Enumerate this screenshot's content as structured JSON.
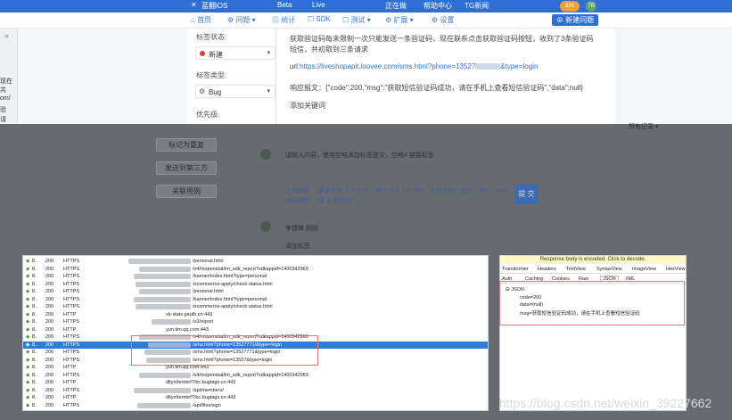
{
  "topbar": {
    "items": [
      "蓝翻iOS",
      "Beta",
      "Live",
      "正在做",
      "帮助中心",
      "TG新闻"
    ],
    "badge": "826",
    "avatar2": "TB"
  },
  "nav": {
    "home": "首页",
    "issues": "问题",
    "stats": "统计",
    "sdk": "SDK",
    "test": "测试",
    "ext": "扩展",
    "settings": "设置",
    "new_issue": "新建问题"
  },
  "sidepanel": {
    "status_label": "标签状态:",
    "status_value": "新建",
    "type_label": "标签类型:",
    "type_value": "Bug",
    "priority_label": "优先级:"
  },
  "content": {
    "line1": "获取验证码每未限制一次只能发送一条验证码，现在联系点击获取验证码按钮，收到了3条验证码",
    "line2": "短信，共初取到三条请求",
    "url_prefix": "url:",
    "url": "https://liveshopapit.loovee.com/sms.html?phone=13527",
    "url_suffix": "&type=login",
    "resp": "响应报文：{\"code\":200,\"msg\":\"获取短信验证码成功，请在手机上查看短信验证码\",\"data\":null}",
    "add_keyword": "添加关键词"
  },
  "overlay": {
    "btn1": "标记为重复",
    "btn2": "发送到第三方",
    "btn3": "关联用例",
    "sort": "所有记录",
    "comment_placeholder": "请输入内容，使用空格添加标签提交，空格# 链接标签",
    "upload": "上传附件 （最多上传 3 个文件，每个小于 100 MB，支持文档、图片、IPA、APK 和压缩包） 或 从剪贴板",
    "submit": "提 交",
    "user": "李建峰",
    "user_note": "刚刚",
    "add_label": "添加标签"
  },
  "fiddler": {
    "rows": [
      {
        "id": "8..",
        "code": "200",
        "proto": "HTTPS",
        "url": "/personal.html"
      },
      {
        "id": "8..",
        "code": "200",
        "proto": "HTTPS",
        "url": "/v4/mopenstat/im_sdk_report?sdkappid=1400342969"
      },
      {
        "id": "8..",
        "code": "200",
        "proto": "HTTPS",
        "url": "/banner/index.html?type=personal"
      },
      {
        "id": "8..",
        "code": "200",
        "proto": "HTTPS",
        "url": "/ecommerce-apply/check-status.html"
      },
      {
        "id": "8..",
        "code": "200",
        "proto": "HTTPS",
        "url": "/personal.html"
      },
      {
        "id": "8..",
        "code": "200",
        "proto": "HTTPS",
        "url": "/banner/index.html?type=personal"
      },
      {
        "id": "8..",
        "code": "200",
        "proto": "HTTPS",
        "url": "/ecommerce-apply/check-status.html"
      },
      {
        "id": "8..",
        "code": "200",
        "proto": "HTTP",
        "url": "xk-stats.gauth.cn:443"
      },
      {
        "id": "8..",
        "code": "200",
        "proto": "HTTPS",
        "url": "/v3/report"
      },
      {
        "id": "8..",
        "code": "200",
        "proto": "HTTP",
        "url": "yun.tim.qq.com:443"
      },
      {
        "id": "8..",
        "code": "200",
        "proto": "HTTPS",
        "url": "/v4/mopenstat/im_sdk_report?sdkappid=1400342969"
      },
      {
        "id": "8..",
        "code": "200",
        "proto": "HTTPS",
        "url": "/sms.html?phone=13527771/&type=login"
      },
      {
        "id": "8..",
        "code": "200",
        "proto": "HTTPS",
        "url": "/sms.html?phone=13527771&type=login"
      },
      {
        "id": "8..",
        "code": "200",
        "proto": "HTTPS",
        "url": "/sms.html?phone=13527&type=login"
      },
      {
        "id": "8..",
        "code": "200",
        "proto": "HTTP",
        "url": "yun.tim.qq.com:443"
      },
      {
        "id": "8..",
        "code": "200",
        "proto": "HTTPS",
        "url": "/v4/mopenstat/im_sdk_report?sdkappid=1400342969"
      },
      {
        "id": "8..",
        "code": "200",
        "proto": "HTTP",
        "url": "dltyn/tembrf7/bc.bugtags.cn:443"
      },
      {
        "id": "8..",
        "code": "200",
        "proto": "HTTPS",
        "url": "/api/members/"
      },
      {
        "id": "8..",
        "code": "200",
        "proto": "HTTP",
        "url": "dltyn/tembrf7/bc.bugtags.cn:443"
      },
      {
        "id": "8..",
        "code": "200",
        "proto": "HTTPS",
        "url": "/api/files/sign"
      }
    ]
  },
  "inspector": {
    "notice": "Response body is encoded. Click to decode.",
    "tabs1": [
      "Transformer",
      "Headers",
      "TextView",
      "SyntaxView",
      "ImageView",
      "HexView"
    ],
    "tabs2": [
      "Auth",
      "Caching",
      "Cookies",
      "Raw",
      "JSON",
      "XML"
    ],
    "tree_root": "JSON",
    "tree1": "code=200",
    "tree2": "data=(null)",
    "tree3": "msg=获取短信验证码成功，请在手机上查看短信验证码"
  },
  "watermark": "https://blog.csdn.net/weixin_39227662",
  "left_fragments": [
    "现在",
    "共",
    "om/",
    "验",
    "请"
  ]
}
